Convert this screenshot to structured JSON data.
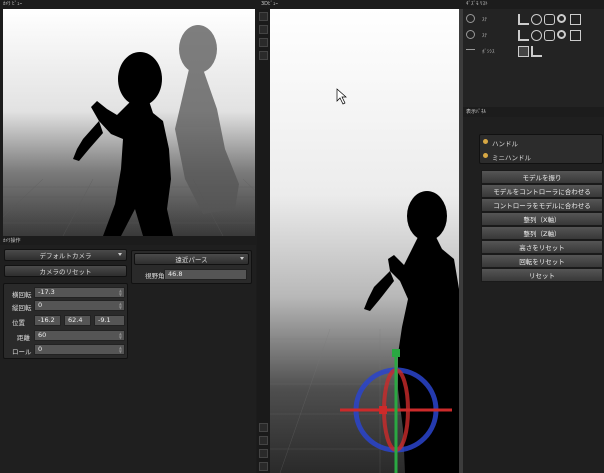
{
  "camera_view": {
    "title": "ｶﾒﾗ ﾋﾞｭｰ"
  },
  "viewport_3d": {
    "title": "3Dﾋﾞｭｰ"
  },
  "gizmo_panel": {
    "title": "ｷﾞｽﾞﾓ  ﾘｽﾄ",
    "items": [
      {
        "label": "ｽﾃ"
      },
      {
        "label": "ｽﾃ"
      },
      {
        "label": "ﾎﾞｼｼｽ"
      }
    ]
  },
  "camera_ops": {
    "title": "ｶﾒﾗ操作",
    "camera_select": "デフォルトカメラ",
    "reset_button": "カメラのリセット",
    "lens_select": "遠近パース",
    "fov_label": "視野角",
    "fov_value": "46.8",
    "fields": [
      {
        "label": "横回転",
        "value": "-17.3"
      },
      {
        "label": "縦回転",
        "value": "0"
      },
      {
        "label": "位置",
        "values": [
          "-16.2",
          "62.4",
          "-9.1"
        ]
      },
      {
        "label": "距離",
        "value": "60"
      },
      {
        "label": "ロール",
        "value": "0"
      }
    ]
  },
  "display_panel": {
    "title": "表示ﾊﾟﾈﾙ",
    "radios": [
      {
        "label": "ハンドル"
      },
      {
        "label": "ミニハンドル"
      }
    ]
  },
  "actions": [
    {
      "label": "モデルを振り"
    },
    {
      "label": "モデルをコントローラに合わせる"
    },
    {
      "label": "コントローラをモデルに合わせる"
    },
    {
      "label": "整列（X軸）"
    },
    {
      "label": "整列（Z軸）"
    },
    {
      "label": "高さをリセット"
    },
    {
      "label": "回転をリセット"
    },
    {
      "label": "リセット"
    }
  ],
  "colors": {
    "bg": "#1c1c1c",
    "panel": "#2b2b2b",
    "accent": "#d8a844",
    "gizmo_x": "#cc2a2a",
    "gizmo_y": "#2aa842",
    "gizmo_z": "#2a44cc"
  }
}
